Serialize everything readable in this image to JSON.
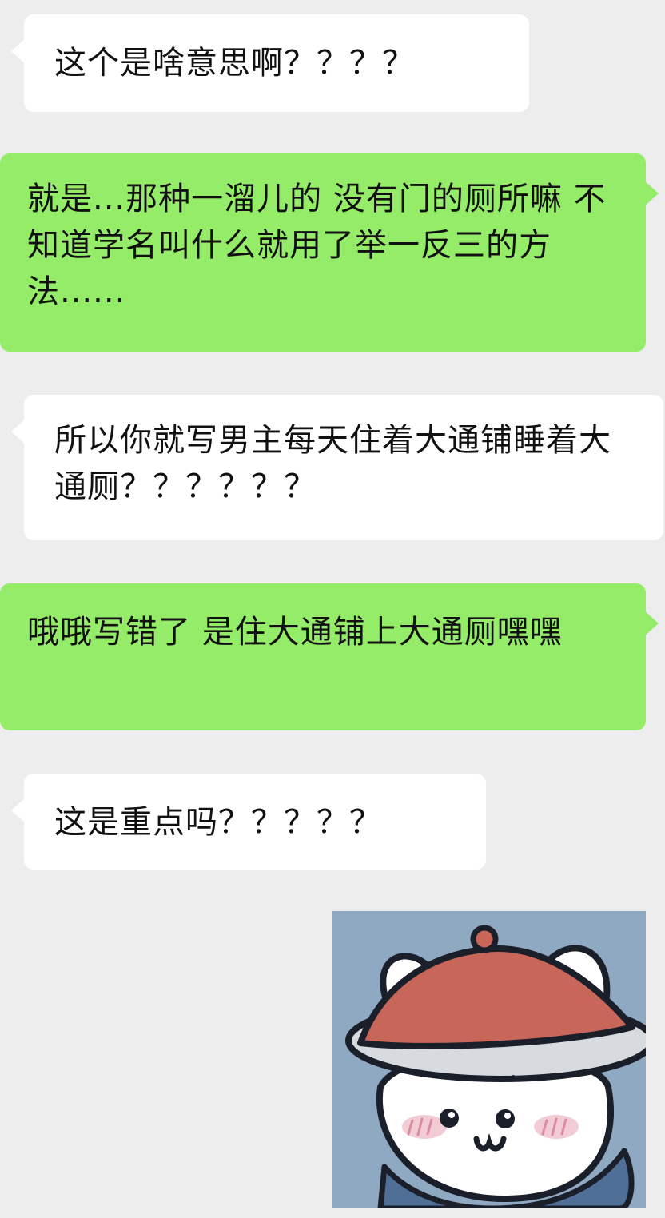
{
  "conversation": {
    "messages": [
      {
        "side": "left",
        "text": "这个是啥意思啊？？？？"
      },
      {
        "side": "right",
        "text": "就是...那种一溜儿的 没有门的厕所嘛 不知道学名叫什么就用了举一反三的方法......"
      },
      {
        "side": "left",
        "text": "所以你就写男主每天住着大通铺睡着大通厕？？？？？？"
      },
      {
        "side": "right",
        "text": "哦哦写错了 是住大通铺上大通厕嘿嘿"
      },
      {
        "side": "left",
        "text": "这是重点吗？？？？？"
      }
    ],
    "sticker": {
      "icon": "cat-in-straw-hat-sticker"
    }
  },
  "colors": {
    "background": "#ededed",
    "incoming_bubble": "#ffffff",
    "outgoing_bubble": "#95ec69",
    "sticker_background": "#8fa9c2",
    "hat_red": "#c9665a"
  }
}
